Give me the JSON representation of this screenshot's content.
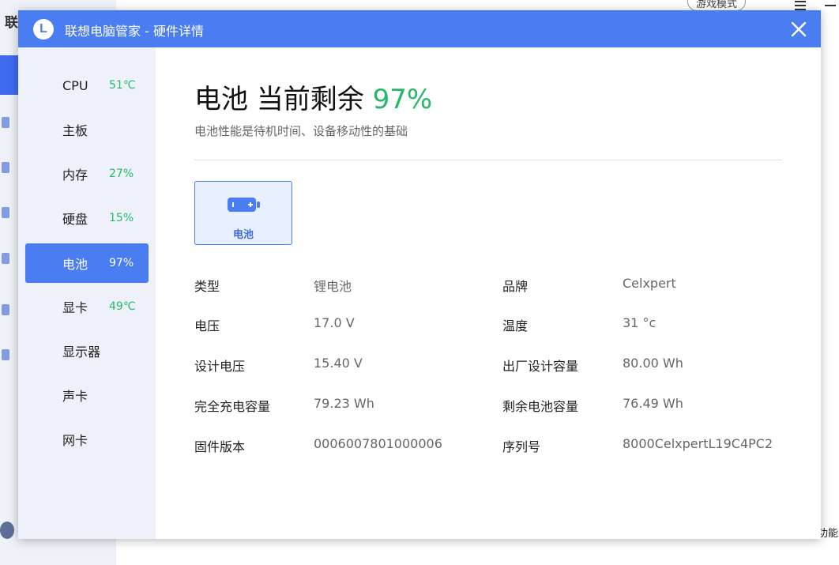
{
  "background_app": {
    "title_fragment": "联",
    "right_text_fragment": "功能",
    "game_mode_label": "游戏模式"
  },
  "dialog": {
    "title": "联想电脑管家 - 硬件详情",
    "logo_letter": "L"
  },
  "sidebar": {
    "items": [
      {
        "label": "CPU",
        "value": "51℃"
      },
      {
        "label": "主板",
        "value": ""
      },
      {
        "label": "内存",
        "value": "27%"
      },
      {
        "label": "硬盘",
        "value": "15%"
      },
      {
        "label": "电池",
        "value": "97%"
      },
      {
        "label": "显卡",
        "value": "49℃"
      },
      {
        "label": "显示器",
        "value": ""
      },
      {
        "label": "声卡",
        "value": ""
      },
      {
        "label": "网卡",
        "value": ""
      }
    ],
    "active": "电池"
  },
  "main": {
    "heading": "电池 当前剩余 ",
    "heading_value": "97%",
    "subtitle": "电池性能是待机时间、设备移动性的基础",
    "battery_card_label": "电池",
    "details": [
      {
        "label": "类型",
        "value": "锂电池"
      },
      {
        "label": "品牌",
        "value": "Celxpert"
      },
      {
        "label": "电压",
        "value": "17.0 V"
      },
      {
        "label": "温度",
        "value": "31 °c"
      },
      {
        "label": "设计电压",
        "value": "15.40 V"
      },
      {
        "label": "出厂设计容量",
        "value": "80.00 Wh"
      },
      {
        "label": "完全充电容量",
        "value": "79.23 Wh"
      },
      {
        "label": "剩余电池容量",
        "value": "76.49 Wh"
      },
      {
        "label": "固件版本",
        "value": "0006007801000006"
      },
      {
        "label": "序列号",
        "value": "8000CelxpertL19C4PC2"
      }
    ]
  },
  "colors": {
    "accent": "#4a7cf2",
    "good": "#25b86a"
  }
}
